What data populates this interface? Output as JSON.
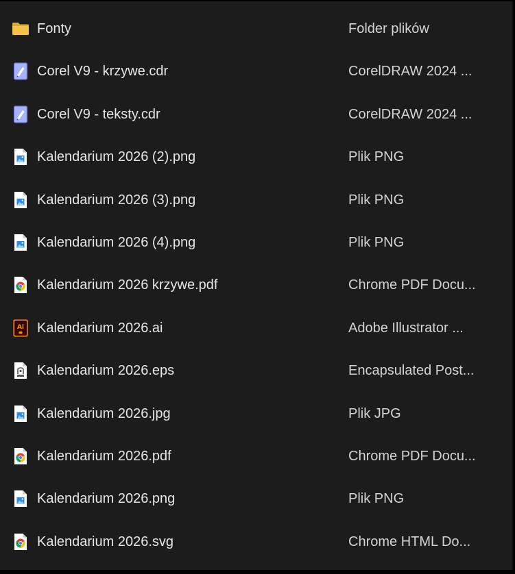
{
  "files": [
    {
      "name": "Fonty",
      "type": "Folder plików",
      "icon": "folder-icon"
    },
    {
      "name": "Corel V9 - krzywe.cdr",
      "type": "CorelDRAW 2024 ...",
      "icon": "coreldraw-file-icon"
    },
    {
      "name": "Corel V9 - teksty.cdr",
      "type": "CorelDRAW 2024 ...",
      "icon": "coreldraw-file-icon"
    },
    {
      "name": "Kalendarium 2026 (2).png",
      "type": "Plik PNG",
      "icon": "image-file-icon"
    },
    {
      "name": "Kalendarium 2026 (3).png",
      "type": "Plik PNG",
      "icon": "image-file-icon"
    },
    {
      "name": "Kalendarium 2026 (4).png",
      "type": "Plik PNG",
      "icon": "image-file-icon"
    },
    {
      "name": "Kalendarium 2026 krzywe.pdf",
      "type": "Chrome PDF Docu...",
      "icon": "chrome-file-icon"
    },
    {
      "name": "Kalendarium 2026.ai",
      "type": "Adobe Illustrator ...",
      "icon": "illustrator-file-icon"
    },
    {
      "name": "Kalendarium 2026.eps",
      "type": "Encapsulated Post...",
      "icon": "eps-file-icon"
    },
    {
      "name": "Kalendarium 2026.jpg",
      "type": "Plik JPG",
      "icon": "image-file-icon"
    },
    {
      "name": "Kalendarium 2026.pdf",
      "type": "Chrome PDF Docu...",
      "icon": "chrome-file-icon"
    },
    {
      "name": "Kalendarium 2026.png",
      "type": "Plik PNG",
      "icon": "image-file-icon"
    },
    {
      "name": "Kalendarium 2026.svg",
      "type": "Chrome HTML Do...",
      "icon": "chrome-file-icon"
    }
  ],
  "colors": {
    "background": "#1c1c1c",
    "text": "#e6e6e6",
    "folder": "#f5c34a"
  }
}
